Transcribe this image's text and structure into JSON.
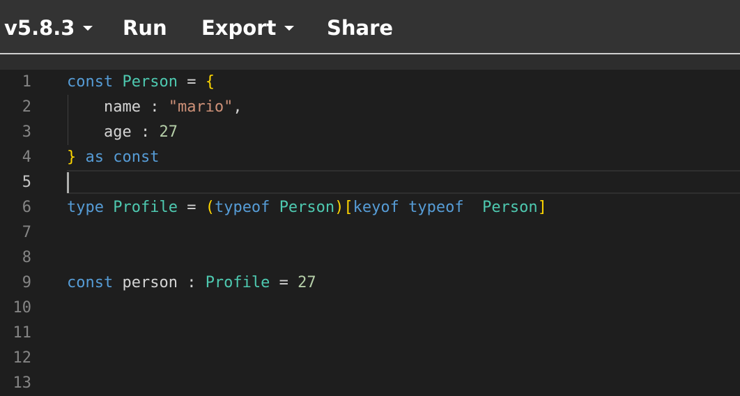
{
  "toolbar": {
    "version_label": "v5.8.3",
    "run_label": "Run",
    "export_label": "Export",
    "share_label": "Share"
  },
  "editor": {
    "line_numbers": [
      "1",
      "2",
      "3",
      "4",
      "5",
      "6",
      "7",
      "8",
      "9",
      "10",
      "11",
      "12",
      "13"
    ],
    "active_line": 5,
    "lines": [
      [
        {
          "t": "const",
          "c": "kw"
        },
        {
          "t": " ",
          "c": "pun"
        },
        {
          "t": "Person",
          "c": "ty"
        },
        {
          "t": " = ",
          "c": "pun"
        },
        {
          "t": "{",
          "c": "br1"
        }
      ],
      [
        {
          "t": "    name : ",
          "c": "pun"
        },
        {
          "t": "\"mario\"",
          "c": "str"
        },
        {
          "t": ",",
          "c": "pun"
        }
      ],
      [
        {
          "t": "    age : ",
          "c": "pun"
        },
        {
          "t": "27",
          "c": "num"
        }
      ],
      [
        {
          "t": "}",
          "c": "br1"
        },
        {
          "t": " ",
          "c": "pun"
        },
        {
          "t": "as",
          "c": "kw"
        },
        {
          "t": " ",
          "c": "pun"
        },
        {
          "t": "const",
          "c": "kw"
        }
      ],
      [],
      [
        {
          "t": "type",
          "c": "kw"
        },
        {
          "t": " ",
          "c": "pun"
        },
        {
          "t": "Profile",
          "c": "ty"
        },
        {
          "t": " = ",
          "c": "pun"
        },
        {
          "t": "(",
          "c": "br1"
        },
        {
          "t": "typeof",
          "c": "kw"
        },
        {
          "t": " ",
          "c": "pun"
        },
        {
          "t": "Person",
          "c": "ty"
        },
        {
          "t": ")",
          "c": "br1"
        },
        {
          "t": "[",
          "c": "br1"
        },
        {
          "t": "keyof",
          "c": "kw"
        },
        {
          "t": " ",
          "c": "pun"
        },
        {
          "t": "typeof",
          "c": "kw"
        },
        {
          "t": "  ",
          "c": "pun"
        },
        {
          "t": "Person",
          "c": "ty"
        },
        {
          "t": "]",
          "c": "br1"
        }
      ],
      [],
      [],
      [
        {
          "t": "const",
          "c": "kw"
        },
        {
          "t": " person : ",
          "c": "pun"
        },
        {
          "t": "Profile",
          "c": "ty"
        },
        {
          "t": " = ",
          "c": "pun"
        },
        {
          "t": "27",
          "c": "num"
        }
      ],
      [],
      [],
      [],
      []
    ]
  }
}
